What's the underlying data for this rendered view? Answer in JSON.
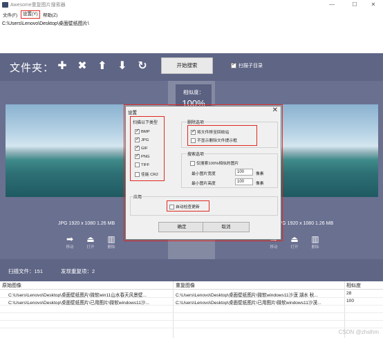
{
  "window": {
    "title": "Awesome重复图片搜索器",
    "min": "—",
    "max": "☐",
    "close": "✕"
  },
  "menu": [
    "文件(F)",
    "设置(Y)",
    "帮助(Z)"
  ],
  "path": "C:\\Users\\Lenovo\\Desktop\\桌面壁纸图片\\",
  "toolbar": {
    "label": "文件夹：",
    "icons": [
      "plus-icon",
      "close-icon",
      "arrow-up-icon",
      "arrow-down-icon",
      "refresh-icon"
    ],
    "start": "开始搜索",
    "subdir_label": "扫描子目录",
    "subdir_checked": true
  },
  "similarity": {
    "label": "相似度：",
    "value": "100%"
  },
  "left_image": {
    "info": "JPG  1920 x 1080  1.26 MB",
    "actions": [
      "移动",
      "打开",
      "删除"
    ]
  },
  "right_image": {
    "info": "JPG  1920 x 1080  1.26 MB",
    "actions": [
      "移动",
      "打开",
      "删除"
    ]
  },
  "status": {
    "scanned": "扫描文件：151",
    "dups": "发现重复项：2"
  },
  "table": {
    "headers": [
      "原始图像",
      "重复图像",
      "相似度"
    ],
    "rows": [
      [
        "C:\\Users\\Lenovo\\Desktop\\桌面壁纸图片\\微软win11山水春天风景壁...",
        "C:\\Users\\Lenovo\\Desktop\\桌面壁纸图片\\微软windows11沙漠 湖水 秋...",
        "28"
      ],
      [
        "C:\\Users\\Lenovo\\Desktop\\桌面壁纸图片\\已用图片\\微软windows11沙...",
        "C:\\Users\\Lenovo\\Desktop\\桌面壁纸图片\\已用图片\\微软windows11沙漠...",
        "100"
      ]
    ]
  },
  "watermark": "CSDN @zhslhm",
  "dialog": {
    "title": "设置",
    "close": "✕",
    "scan_types_title": "扫描以下类型",
    "types": [
      {
        "label": "BMP",
        "checked": true
      },
      {
        "label": "JPG",
        "checked": true
      },
      {
        "label": "GIF",
        "checked": true
      },
      {
        "label": "PNG",
        "checked": true
      },
      {
        "label": "TIFF",
        "checked": false
      },
      {
        "label": "佳能 CR2",
        "checked": false
      }
    ],
    "delete_title": "删除选项",
    "delete_opts": [
      {
        "label": "将文件移至回收站",
        "checked": true
      },
      {
        "label": "不显示删除文件提示框",
        "checked": false
      }
    ],
    "search_title": "搜索选项",
    "search_only100": "仅搜索100%相似的图片",
    "min_width_label": "最小图片宽度",
    "min_width": "100",
    "min_height_label": "最小图片高度",
    "min_height": "100",
    "unit": "像素",
    "app_title": "应用",
    "auto_update": "自动检查更新",
    "auto_update_checked": false,
    "ok": "确定",
    "cancel": "取消"
  }
}
